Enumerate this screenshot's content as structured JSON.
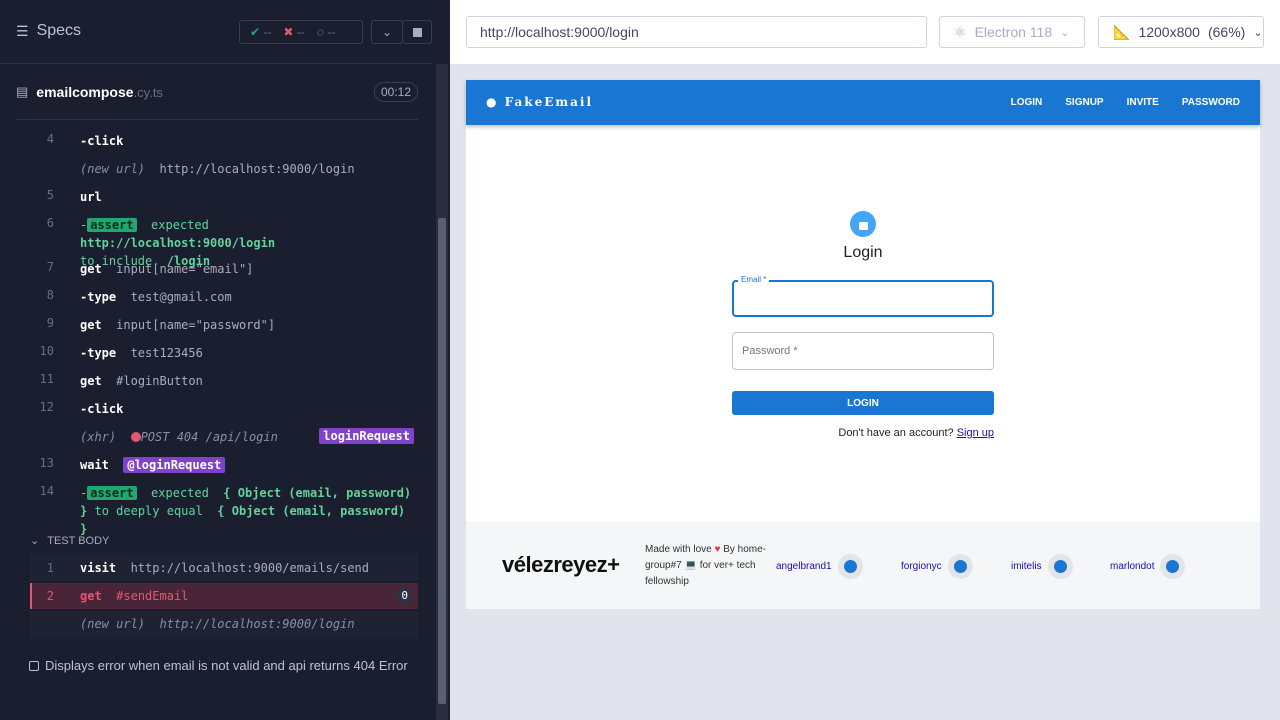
{
  "runner": {
    "specs_label": "Specs",
    "stats": {
      "passed": "--",
      "failed": "--",
      "pending": "--"
    },
    "file": {
      "name": "emailcompose",
      "ext": ".cy.ts",
      "timer": "00:12"
    },
    "commands": [
      {
        "num": "4",
        "cmd": "-click",
        "arg": ""
      },
      {
        "num": "",
        "dim": "(new url)",
        "arg": "http://localhost:9000/login"
      },
      {
        "num": "5",
        "cmd": "url",
        "arg": ""
      },
      {
        "num": "6",
        "assert": "assert",
        "text1": "expected",
        "bold1": "http://localhost:9000/login",
        "text2": "to include",
        "bold2": "/login"
      },
      {
        "num": "7",
        "cmd": "get",
        "arg": "input[name=\"email\"]"
      },
      {
        "num": "8",
        "cmd": "-type",
        "arg": "test@gmail.com"
      },
      {
        "num": "9",
        "cmd": "get",
        "arg": "input[name=\"password\"]"
      },
      {
        "num": "10",
        "cmd": "-type",
        "arg": "test123456"
      },
      {
        "num": "11",
        "cmd": "get",
        "arg": "#loginButton"
      },
      {
        "num": "12",
        "cmd": "-click",
        "arg": ""
      },
      {
        "num": "",
        "dim": "(xhr)",
        "arg": "POST 404 /api/login",
        "alias": "loginRequest"
      },
      {
        "num": "13",
        "cmd": "wait",
        "alias": "@loginRequest"
      },
      {
        "num": "14",
        "assert": "assert",
        "text1": "expected",
        "bold1": "{ Object (email, password) }",
        "text2": "to deeply equal",
        "bold2": "{ Object (email, password) }"
      }
    ],
    "test_body_label": "TEST BODY",
    "test_body": [
      {
        "num": "1",
        "cmd": "visit",
        "arg": "http://localhost:9000/emails/send"
      },
      {
        "num": "2",
        "cmd": "get",
        "arg": "#sendEmail",
        "count": "0"
      },
      {
        "num": "",
        "dim": "(new url)",
        "arg": "http://localhost:9000/login"
      }
    ],
    "suite_label": "Displays error when email is not valid and api returns 404 Error"
  },
  "browser_bar": {
    "url": "http://localhost:9000/login",
    "browser": "Electron 118",
    "viewport": "1200x800",
    "zoom": "(66%)"
  },
  "app": {
    "brand": "FakeEmail",
    "nav": [
      "LOGIN",
      "SIGNUP",
      "INVITE",
      "PASSWORD"
    ],
    "title": "Login",
    "email_label": "Email *",
    "password_placeholder": "Password *",
    "login_button": "LOGIN",
    "signup_prompt": "Don't have an account?",
    "signup_link": "Sign up",
    "footer": {
      "logo": "vélezreyez+",
      "made_with": "Made with love",
      "by": "By home-group#7",
      "fellowship": "for ver+ tech fellowship",
      "members": [
        "angelbrand1",
        "forgionyc",
        "imitelis",
        "marlondot"
      ]
    }
  },
  "colors": {
    "accent": "#1976d2",
    "pass": "#1fa971",
    "fail": "#e45770",
    "alias": "#7f43c9"
  }
}
